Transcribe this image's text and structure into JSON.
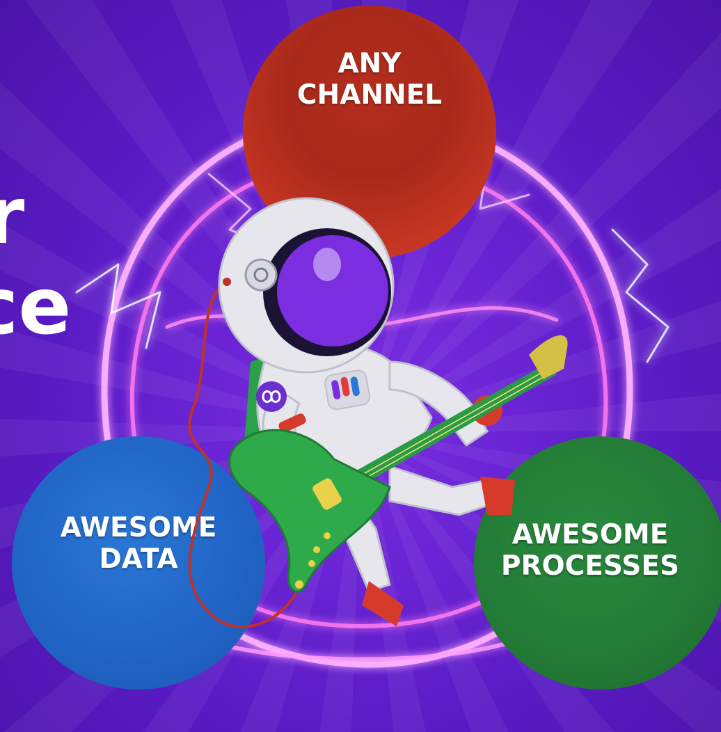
{
  "headline": {
    "line1_fragment": "r",
    "line2_fragment": "ce"
  },
  "planets": {
    "top": {
      "line1": "ANY",
      "line2": "CHANNEL",
      "color": "#b52e1d"
    },
    "left": {
      "line1": "AWESOME",
      "line2": "DATA",
      "color": "#2063c4"
    },
    "right": {
      "line1": "AWESOME",
      "line2": "PROCESSES",
      "color": "#227a35"
    }
  },
  "colors": {
    "background": "#6a24d4",
    "lightning": "#ff9cff",
    "guitar": "#2faa4a",
    "astronaut_suit": "#e6e6ec",
    "visor": "#7a2ee0"
  },
  "icons": {
    "suit_logo": "infinity-logo-icon"
  }
}
